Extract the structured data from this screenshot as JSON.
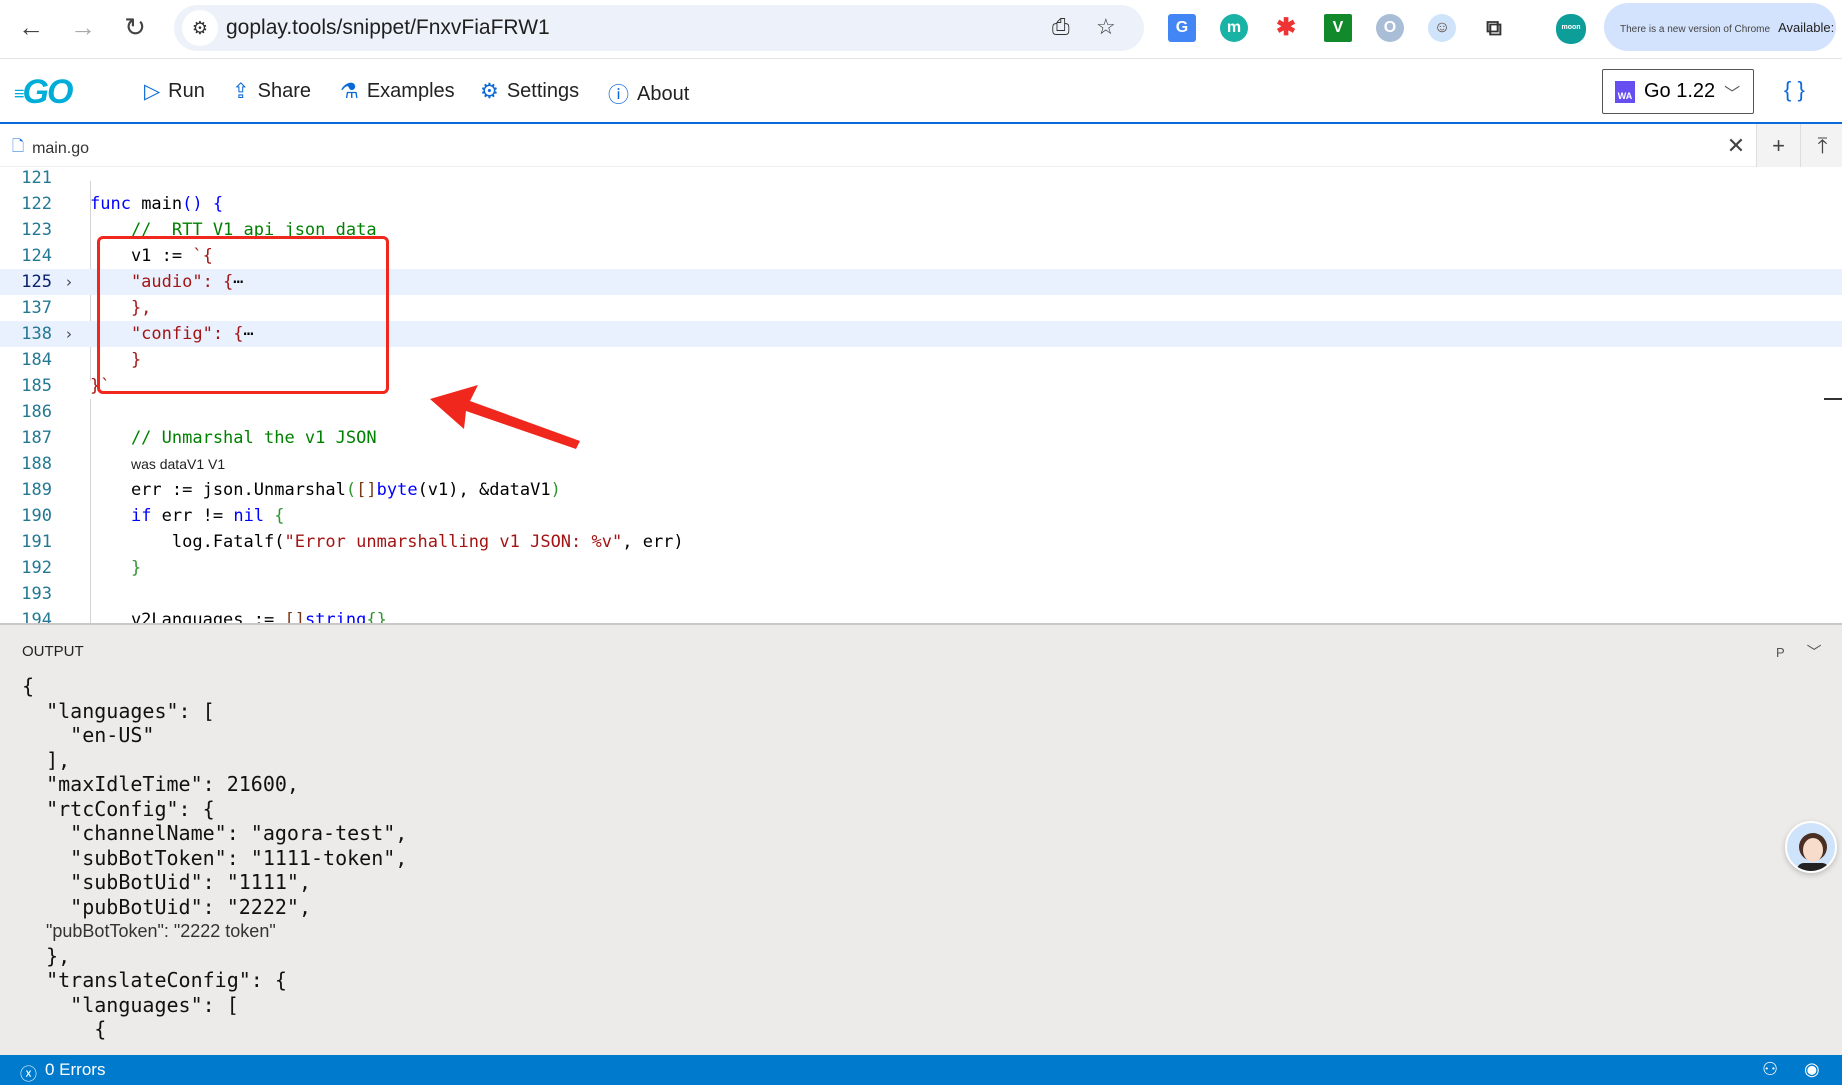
{
  "browser": {
    "url": "goplay.tools/snippet/FnxvFiaFRW1",
    "update_text": "There is a new version of Chrome",
    "update_action": "Available:",
    "ext_labels": [
      "G",
      "m",
      "✱",
      "V",
      "O",
      "☺",
      "moon"
    ]
  },
  "toolbar": {
    "logo": "GO",
    "run": "Run",
    "share": "Share",
    "examples": "Examples",
    "settings": "Settings",
    "about": "About",
    "version": "Go 1.22",
    "version_badge": "WA"
  },
  "tab": {
    "filename": "main.go"
  },
  "editor": {
    "lines": [
      {
        "n": "121",
        "t": []
      },
      {
        "n": "122",
        "t": [
          [
            "func ",
            "kw"
          ],
          [
            "main",
            ""
          ],
          [
            "()",
            "kw"
          ],
          [
            " {",
            "kw"
          ]
        ]
      },
      {
        "n": "123",
        "t": [
          [
            "    //  RTT V1 api json data",
            "cm"
          ]
        ]
      },
      {
        "n": "124",
        "t": [
          [
            "    v1 := ",
            ""
          ],
          [
            "`{",
            "str"
          ]
        ]
      },
      {
        "n": "125",
        "t": [
          [
            "    \"audio\": {",
            "str"
          ],
          [
            "⋯",
            ""
          ]
        ],
        "fold": true,
        "hl": true,
        "cur": true
      },
      {
        "n": "137",
        "t": [
          [
            "    },",
            "str"
          ]
        ]
      },
      {
        "n": "138",
        "t": [
          [
            "    \"config\": {",
            "str"
          ],
          [
            "⋯",
            ""
          ]
        ],
        "fold": true,
        "hl": true
      },
      {
        "n": "184",
        "t": [
          [
            "    }",
            "str"
          ]
        ]
      },
      {
        "n": "185",
        "t": [
          [
            "}`",
            "str"
          ]
        ]
      },
      {
        "n": "186",
        "t": []
      },
      {
        "n": "187",
        "t": [
          [
            "    // Unmarshal the v1 JSON",
            "cm"
          ]
        ]
      },
      {
        "n": "188",
        "t": [
          [
            "    ",
            ""
          ],
          [
            "was dataV1 V1",
            "hint"
          ]
        ]
      },
      {
        "n": "189",
        "t": [
          [
            "    err := json.Unmarshal",
            ""
          ],
          [
            "(",
            "br"
          ],
          [
            "[]",
            "br2"
          ],
          [
            "byte",
            "kw"
          ],
          [
            "(v1), &dataV1",
            ""
          ],
          [
            ")",
            "br"
          ]
        ]
      },
      {
        "n": "190",
        "t": [
          [
            "    ",
            ""
          ],
          [
            "if",
            "kw"
          ],
          [
            " err != ",
            ""
          ],
          [
            "nil",
            "kw"
          ],
          [
            " {",
            "br"
          ]
        ]
      },
      {
        "n": "191",
        "t": [
          [
            "        log.Fatalf(",
            ""
          ],
          [
            "\"Error unmarshalling v1 JSON: %v\"",
            "str"
          ],
          [
            ", err)",
            ""
          ]
        ]
      },
      {
        "n": "192",
        "t": [
          [
            "    }",
            "br"
          ]
        ]
      },
      {
        "n": "193",
        "t": []
      },
      {
        "n": "194",
        "t": [
          [
            "    v2Languages := ",
            ""
          ],
          [
            "[]",
            "br2"
          ],
          [
            "string",
            "kw"
          ],
          [
            "{}",
            "br"
          ]
        ]
      }
    ]
  },
  "output": {
    "title": "OUTPUT",
    "tool": "P",
    "lines": [
      "{",
      "  \"languages\": [",
      "    \"en-US\"",
      "  ],",
      "  \"maxIdleTime\": 21600,",
      "  \"rtcConfig\": {",
      "    \"channelName\": \"agora-test\",",
      "    \"subBotToken\": \"1111-token\",",
      "    \"subBotUid\": \"1111\",",
      "    \"pubBotUid\": \"2222\",",
      "    \"pubBotToken\": \"2222 token\"",
      "  },",
      "  \"translateConfig\": {",
      "    \"languages\": [",
      "      {"
    ]
  },
  "status": {
    "errors": "0 Errors"
  },
  "colors": {
    "accent": "#007acc",
    "annotation": "#f0271d",
    "go_blue": "#00add8"
  }
}
